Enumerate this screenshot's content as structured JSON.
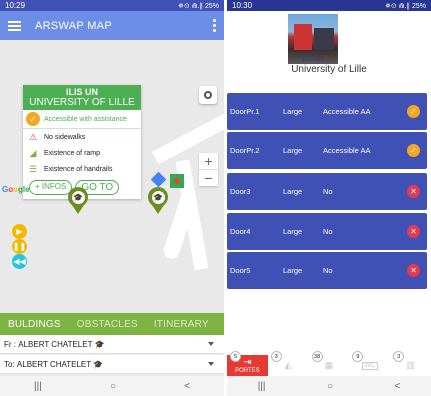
{
  "left": {
    "status": {
      "time": "10:29",
      "right": "✵⊙ ⋒.∥ 25%"
    },
    "appbar": {
      "title": "ARSWAP MAP"
    },
    "info": {
      "name": "ILIS UN",
      "subtitle": "UNIVERSITY OF LILLE",
      "accessible": "Accessible with assistance",
      "items": [
        "No sidewalks",
        "Existence of ramp",
        "Existence of handrails"
      ],
      "more_button": "+ INFOS",
      "goto_button": "GO TO"
    },
    "google": {
      "g": "G",
      "o1": "o",
      "o2": "o",
      "rest": "gle"
    },
    "tabs": [
      "BULDINGS",
      "OBSTACLES",
      "ITINERARY"
    ],
    "from": {
      "prefix": "Fr :",
      "value": "ALBERT CHATELET"
    },
    "to": {
      "prefix": "To:",
      "value": "ALBERT CHATELET"
    }
  },
  "right": {
    "status": {
      "time": "10:30",
      "right": "✵⊙ ⋒.∥ 25%"
    },
    "photo_caption": "ILIS UN",
    "university": "University of Lille",
    "doors": [
      {
        "name": "DoorPr.1",
        "size": "Large",
        "access": "Accessible AA",
        "ok": true
      },
      {
        "name": "DoorPr.2",
        "size": "Large",
        "access": "Accessible AA",
        "ok": true
      },
      {
        "name": "Door3",
        "size": "Large",
        "access": "No",
        "ok": false
      },
      {
        "name": "Door4",
        "size": "Large",
        "access": "No",
        "ok": false
      },
      {
        "name": "Door5",
        "size": "Large",
        "access": "No",
        "ok": false
      }
    ],
    "bottom_tabs": [
      {
        "badge": "5",
        "label": "PORTES"
      },
      {
        "badge": "3",
        "label": ""
      },
      {
        "badge": "38",
        "label": ""
      },
      {
        "badge": "9",
        "label": "WC"
      },
      {
        "badge": "3",
        "label": ""
      }
    ]
  },
  "colors": {
    "indigo": "#3f51b5",
    "green": "#7cb342",
    "orange": "#f5a623",
    "red": "#e53950",
    "blue_bar": "#6d8ee6"
  },
  "nav": {
    "recent": "|||",
    "home": "○",
    "back": "<"
  }
}
